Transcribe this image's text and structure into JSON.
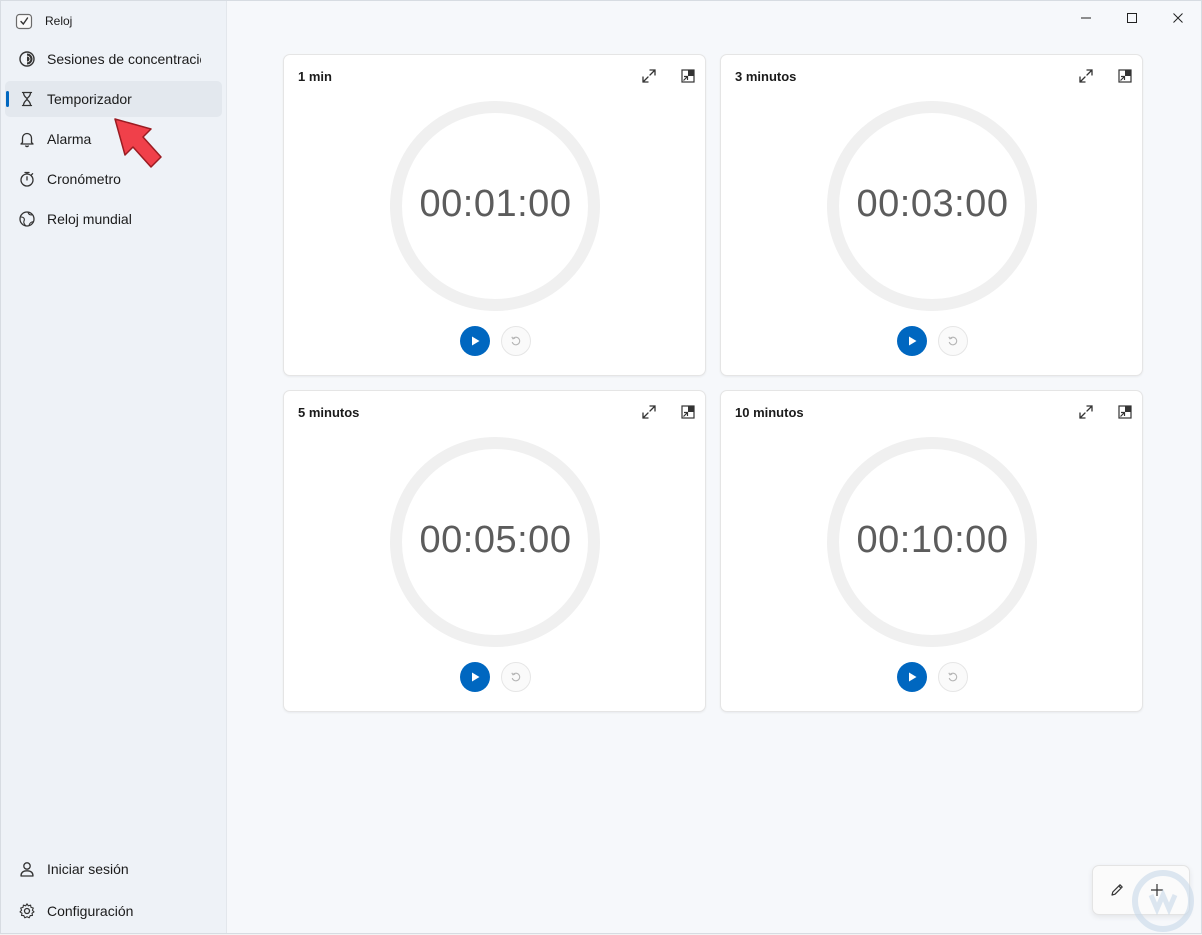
{
  "app": {
    "title": "Reloj"
  },
  "sidebar": {
    "items": [
      {
        "label": "Sesiones de concentració",
        "icon": "focus-icon"
      },
      {
        "label": "Temporizador",
        "icon": "hourglass-icon",
        "active": true
      },
      {
        "label": "Alarma",
        "icon": "bell-icon"
      },
      {
        "label": "Cronómetro",
        "icon": "stopwatch-icon"
      },
      {
        "label": "Reloj mundial",
        "icon": "globe-icon"
      }
    ],
    "bottom_items": [
      {
        "label": "Iniciar sesión",
        "icon": "person-icon"
      },
      {
        "label": "Configuración",
        "icon": "gear-icon"
      }
    ]
  },
  "timers": [
    {
      "name": "1 min",
      "time": "00:01:00"
    },
    {
      "name": "3 minutos",
      "time": "00:03:00"
    },
    {
      "name": "5 minutos",
      "time": "00:05:00"
    },
    {
      "name": "10 minutos",
      "time": "00:10:00"
    }
  ],
  "colors": {
    "accent": "#0067c0",
    "annotation_arrow": "#f0404a"
  }
}
